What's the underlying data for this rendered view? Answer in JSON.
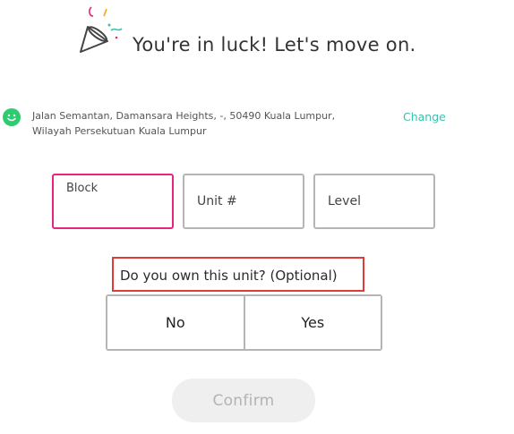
{
  "header": {
    "icon": "party-popper-icon",
    "title": "You're in luck! Let's move on."
  },
  "address": {
    "icon": "smiley-icon",
    "line1": "Jalan Semantan, Damansara Heights, -, 50490 Kuala Lumpur,",
    "line2": "Wilayah Persekutuan Kuala Lumpur",
    "change_label": "Change"
  },
  "form": {
    "block_placeholder": "Block",
    "unit_placeholder": "Unit #",
    "level_placeholder": "Level",
    "ownership_question": "Do you own this unit? (Optional)",
    "options": [
      "No",
      "Yes"
    ],
    "confirm_label": "Confirm"
  },
  "colors": {
    "accent_teal": "#3fbfae",
    "active_field_border": "#e5267f",
    "highlight_border": "#e03b3b",
    "smiley_green": "#2ecc71",
    "disabled_button_bg": "#efefef"
  }
}
